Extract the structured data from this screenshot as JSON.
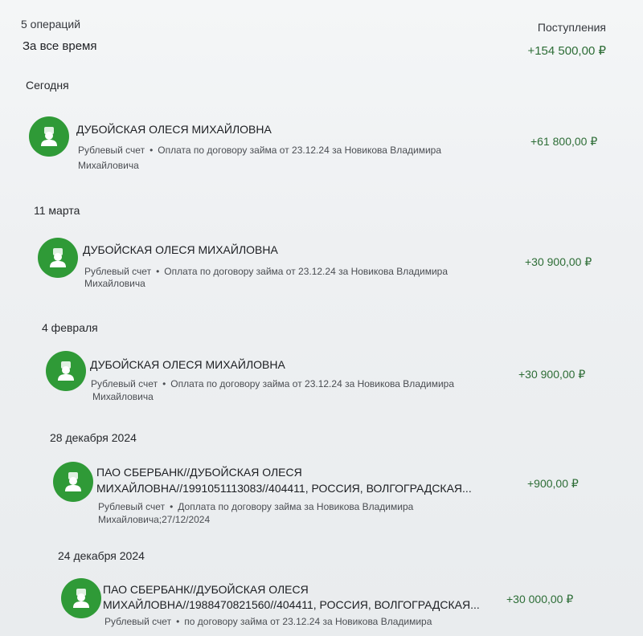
{
  "summary": {
    "count": "5 операций",
    "period": "За все время",
    "income_label": "Поступления",
    "income_amount": "+154 500,00 ₽"
  },
  "groups": [
    {
      "date": "Сегодня",
      "operations": [
        {
          "title_line1": "ДУБОЙСКАЯ ОЛЕСЯ МИХАЙЛОВНА",
          "account": "Рублевый счет",
          "desc_line1": "Оплата по договору займа от 23.12.24 за Новикова Владимира",
          "desc_line2": "Михайловича",
          "amount": "+61 800,00 ₽"
        }
      ]
    },
    {
      "date": "11 марта",
      "operations": [
        {
          "title_line1": "ДУБОЙСКАЯ ОЛЕСЯ МИХАЙЛОВНА",
          "account": "Рублевый счет",
          "desc_line1": "Оплата по договору займа от 23.12.24 за Новикова Владимира",
          "desc_line2": "Михайловича",
          "amount": "+30 900,00 ₽"
        }
      ]
    },
    {
      "date": "4 февраля",
      "operations": [
        {
          "title_line1": "ДУБОЙСКАЯ ОЛЕСЯ МИХАЙЛОВНА",
          "account": "Рублевый счет",
          "desc_line1": "Оплата по договору займа от 23.12.24 за Новикова Владимира",
          "desc_line2": "Михайловича",
          "amount": "+30 900,00 ₽"
        }
      ]
    },
    {
      "date": "28 декабря 2024",
      "operations": [
        {
          "title_line1": "ПАО СБЕРБАНК//ДУБОЙСКАЯ ОЛЕСЯ",
          "title_line2": "МИХАЙЛОВНА//1991051113083//404411, РОССИЯ, ВОЛГОГРАДСКАЯ...",
          "account": "Рублевый счет",
          "desc_line1": "Доплата по договору займа за Новикова Владимира",
          "desc_line2": "Михайловича;27/12/2024",
          "amount": "+900,00 ₽"
        }
      ]
    },
    {
      "date": "24 декабря 2024",
      "operations": [
        {
          "title_line1": "ПАО СБЕРБАНК//ДУБОЙСКАЯ ОЛЕСЯ",
          "title_line2": "МИХАЙЛОВНА//1988470821560//404411, РОССИЯ, ВОЛГОГРАДСКАЯ...",
          "account": "Рублевый счет",
          "desc_line1": "по договору займа от 23.12.24 за Новикова Владимира",
          "amount": "+30 000,00 ₽"
        }
      ]
    }
  ],
  "icon": "person-icon",
  "colors": {
    "accent": "#2f9a37",
    "income": "#2d6d36"
  }
}
